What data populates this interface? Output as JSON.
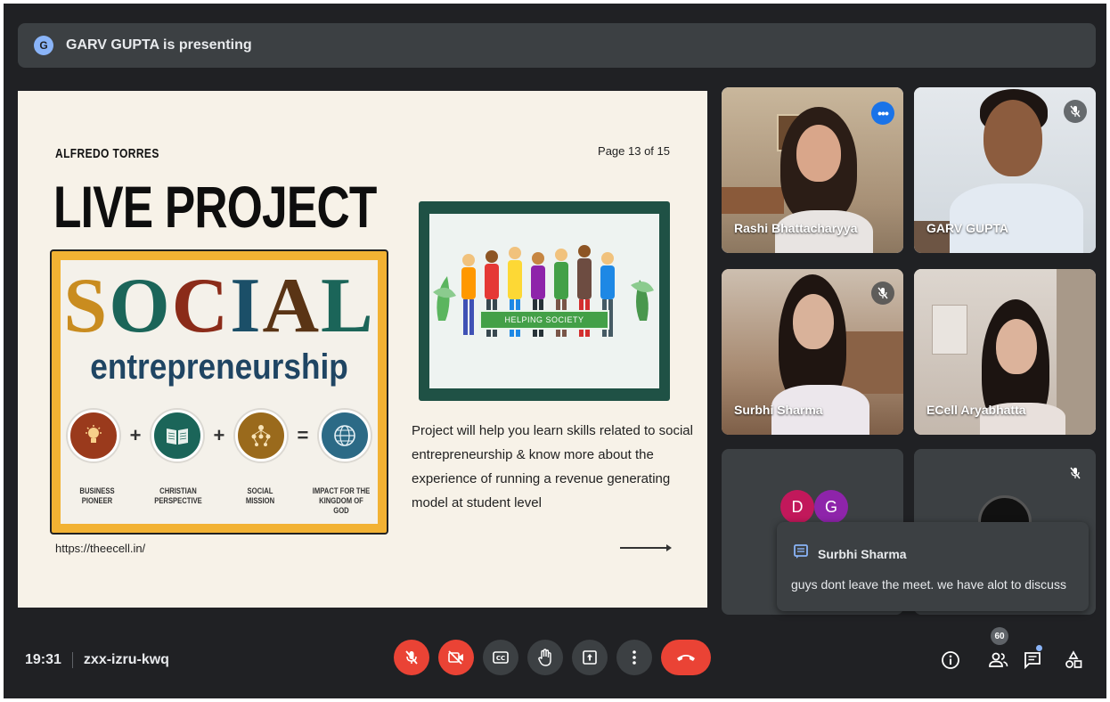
{
  "presenting": {
    "avatar_letter": "G",
    "text": "GARV GUPTA is presenting"
  },
  "slide": {
    "author": "ALFREDO TORRES",
    "page": "Page 13 of 15",
    "title": "LIVE PROJECT",
    "social_letters": [
      "S",
      "O",
      "C",
      "I",
      "A",
      "L"
    ],
    "entrepreneurship": "entrepreneurship",
    "operators": [
      "+",
      "+",
      "="
    ],
    "circle_labels": [
      [
        "BUSINESS",
        "PIONEER"
      ],
      [
        "CHRISTIAN",
        "PERSPECTIVE"
      ],
      [
        "SOCIAL",
        "MISSION"
      ],
      [
        "IMPACT FOR THE",
        "KINGDOM OF GOD"
      ]
    ],
    "url": "https://theecell.in/",
    "banner": "HELPING SOCIETY",
    "description": "Project will help you learn skills related to social entrepreneurship & know more about the experience of running a revenue generating model at student level"
  },
  "tiles": {
    "rashi": "Rashi Bhattacharyya",
    "garv": "GARV GUPTA",
    "surbhi": "Surbhi Sharma",
    "ecell": "ECell Aryabhatta",
    "avatar_d": "D",
    "avatar_g": "G"
  },
  "chat": {
    "sender": "Surbhi Sharma",
    "message": "guys dont leave the meet.  we have alot to discuss"
  },
  "bottom": {
    "time": "19:31",
    "meeting_code": "zxx-izru-kwq",
    "participants_count": "60"
  },
  "colors": {
    "background": "#202124",
    "surface": "#3c4043",
    "danger": "#ea4335",
    "accent": "#8ab4f8",
    "active_blue": "#1a73e8"
  },
  "icons": {
    "mic_off": "mic-off-icon",
    "camera_off": "camera-off-icon",
    "captions": "captions-icon",
    "raise_hand": "raise-hand-icon",
    "present": "present-screen-icon",
    "more": "more-vert-icon",
    "end_call": "end-call-icon",
    "info": "info-icon",
    "people": "people-icon",
    "chat": "chat-icon",
    "activities": "activities-icon"
  }
}
